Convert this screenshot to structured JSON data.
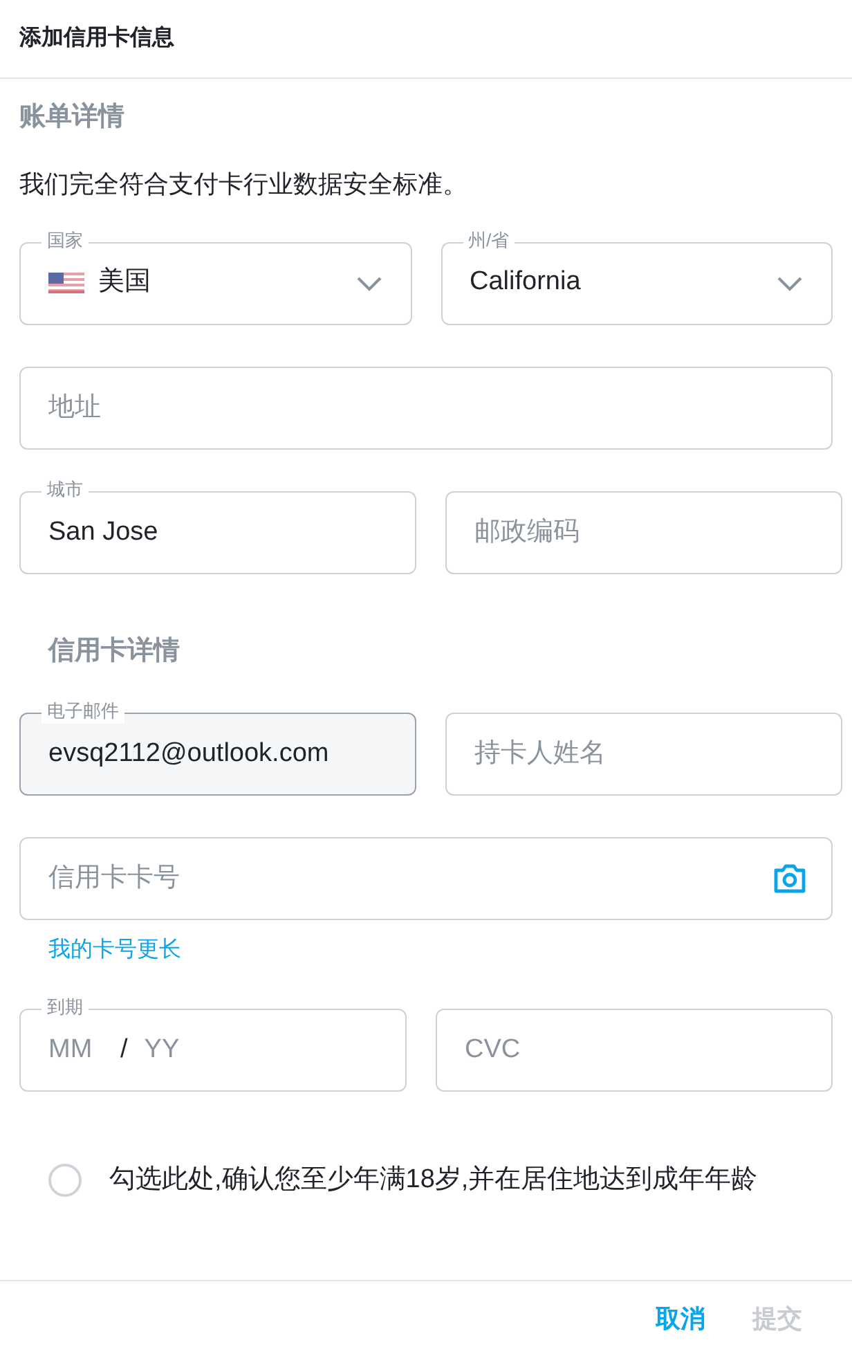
{
  "title": "添加信用卡信息",
  "billing": {
    "heading": "账单详情",
    "notice": "我们完全符合支付卡行业数据安全标准。",
    "rows": [
      {
        "fields": [
          {
            "kind": "country_select",
            "label": "国家",
            "value": "美国",
            "disabled": false
          },
          {
            "kind": "select",
            "label": "州/省",
            "value": "California",
            "disabled": false
          }
        ]
      },
      {
        "fields": [
          {
            "kind": "input",
            "placeholder": "地址",
            "disabled": false
          }
        ]
      },
      {
        "fields": [
          {
            "kind": "input",
            "label": "城市",
            "value": "San Jose",
            "disabled": false
          },
          {
            "kind": "input",
            "placeholder": "邮政编码",
            "disabled": false
          }
        ]
      }
    ]
  },
  "card": {
    "heading": "信用卡详情",
    "rows": [
      {
        "fields": [
          {
            "kind": "input",
            "label": "电子邮件",
            "value": "evsq2112@outlook.com",
            "disabled": true
          },
          {
            "kind": "input",
            "placeholder": "持卡人姓名",
            "disabled": false
          }
        ]
      },
      {
        "fields": [
          {
            "kind": "card_number",
            "placeholder": "信用卡卡号",
            "disabled": false
          }
        ],
        "link": "我的卡号更长"
      },
      {
        "fields": [
          {
            "kind": "expiry",
            "label": "到期",
            "month_placeholder": "MM",
            "separator": "/",
            "year_placeholder": "YY",
            "disabled": false
          },
          {
            "kind": "input",
            "placeholder": "CVC",
            "disabled": false
          }
        ]
      }
    ]
  },
  "age_check": {
    "label": "勾选此处,确认您至少年满18岁,并在居住地达到成年年龄",
    "checked": false
  },
  "buttons": [
    {
      "label": "取消",
      "disabled": false
    },
    {
      "label": "提交",
      "disabled": true
    }
  ]
}
